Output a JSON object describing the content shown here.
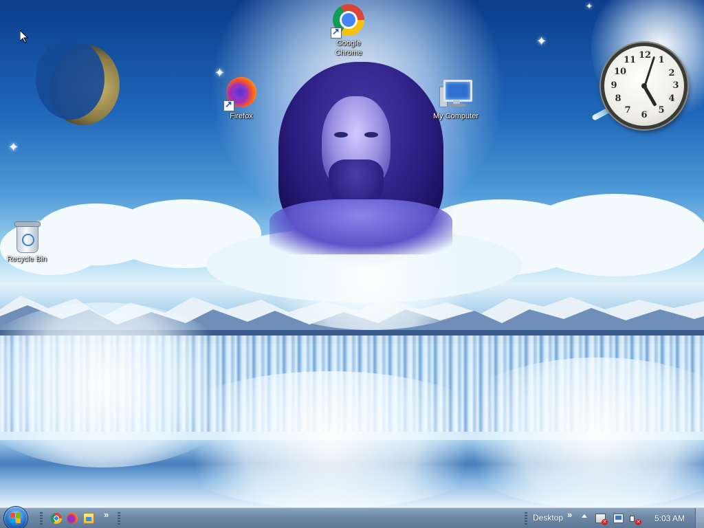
{
  "desktop": {
    "icons": [
      {
        "label": "Google Chrome",
        "icon": "chrome-icon",
        "shortcut": true
      },
      {
        "label": "Firefox",
        "icon": "firefox-icon",
        "shortcut": true
      },
      {
        "label": "My Computer",
        "icon": "computer-icon",
        "shortcut": false
      },
      {
        "label": "Recycle Bin",
        "icon": "recycle-bin-icon",
        "shortcut": false
      }
    ],
    "wallpaper": "heavenly-portrait-waterfall"
  },
  "clock_gadget": {
    "numbers": [
      "12",
      "1",
      "2",
      "3",
      "4",
      "5",
      "6",
      "7",
      "8",
      "9",
      "10",
      "11"
    ],
    "hour": 5,
    "minute": 3
  },
  "taskbar": {
    "start_icon": "windows-logo-icon",
    "quick_launch": [
      "chrome-icon",
      "firefox-icon",
      "folder-icon"
    ],
    "overflow_chevron": "»",
    "toolbar_label": "Desktop",
    "toolbar_chevron": "»",
    "tray_icons": [
      "action-center-flag-icon",
      "network-icon",
      "volume-muted-icon"
    ],
    "time": "5:03 AM"
  },
  "colors": {
    "taskbar": "#6f8aa8",
    "sky_top": "#0c3d8c",
    "accent_blue": "#2f7fd6"
  }
}
